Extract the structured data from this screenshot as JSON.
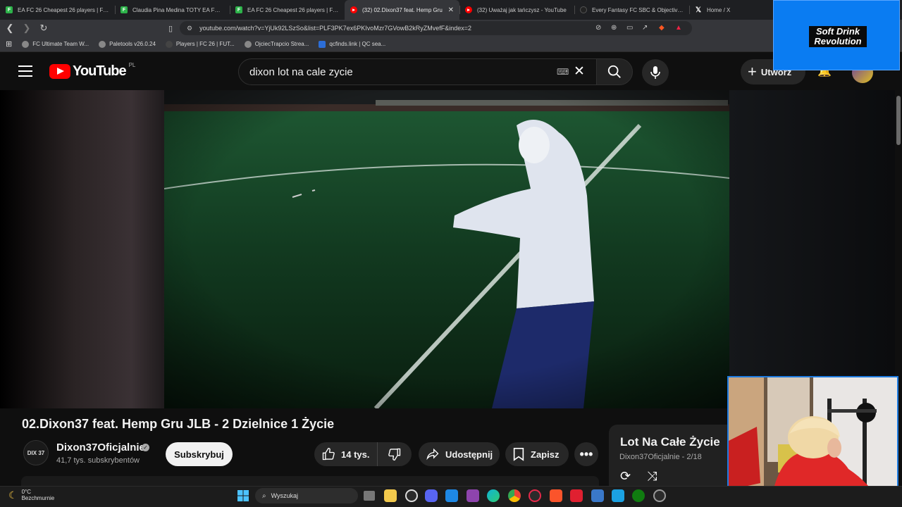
{
  "browser": {
    "tabs": [
      {
        "title": "EA FC 26 Cheapest 26 players | FUTB",
        "icon": "futbin-icon",
        "color": "#2db34a",
        "active": false
      },
      {
        "title": "Claudia Pina Medina TOTY EA FC 26",
        "icon": "futbin-icon",
        "color": "#2db34a",
        "active": false
      },
      {
        "title": "EA FC 26 Cheapest 26 players | FUTB",
        "icon": "futbin-icon",
        "color": "#2db34a",
        "active": false
      },
      {
        "title": "(32) 02.Dixon37 feat. Hemp Gru",
        "icon": "youtube-icon",
        "color": "#ff0000",
        "active": true
      },
      {
        "title": "(32) Uważaj jak tańczysz - YouTube",
        "icon": "youtube-icon",
        "color": "#ff0000",
        "active": false
      },
      {
        "title": "Every Fantasy FC SBC & Objective Pl",
        "icon": "site-icon",
        "color": "#222222",
        "active": false
      },
      {
        "title": "Home / X",
        "icon": "x-icon",
        "color": "#000000",
        "active": false
      }
    ],
    "url": "youtube.com/watch?v=YjUk92LSzSo&list=PLF3PK7ex6PKIvoMzr7GVowB2kRyZMvefF&index=2",
    "bookmarks": [
      "FC Ultimate Team W...",
      "Paletools v26.0.24",
      "Players | FC 26 | FUT...",
      "OjciecTrapcio Strea...",
      "qcfinds.link | QC sea..."
    ]
  },
  "youtube": {
    "logo_text": "YouTube",
    "country": "PL",
    "search_value": "dixon lot na cale zycie",
    "create_label": "Utwórz",
    "video": {
      "title": "02.Dixon37 feat. Hemp Gru JLB - 2 Dzielnice 1 Życie",
      "channel": "Dixon37Oficjalnie",
      "channel_avatar_text": "DIX 37",
      "subscribers": "41,7 tys. subskrybentów",
      "subscribe_label": "Subskrybuj",
      "likes": "14 tys.",
      "share_label": "Udostępnij",
      "save_label": "Zapisz"
    },
    "playlist": {
      "title": "Lot Na Całe Życie",
      "subtitle": "Dixon37Oficjalnie - 2/18"
    }
  },
  "overlay": {
    "brand": "Soft Drink Revolution"
  },
  "taskbar": {
    "temp": "0°C",
    "weather": "Bezchmurnie",
    "search_placeholder": "Wyszukaj"
  }
}
